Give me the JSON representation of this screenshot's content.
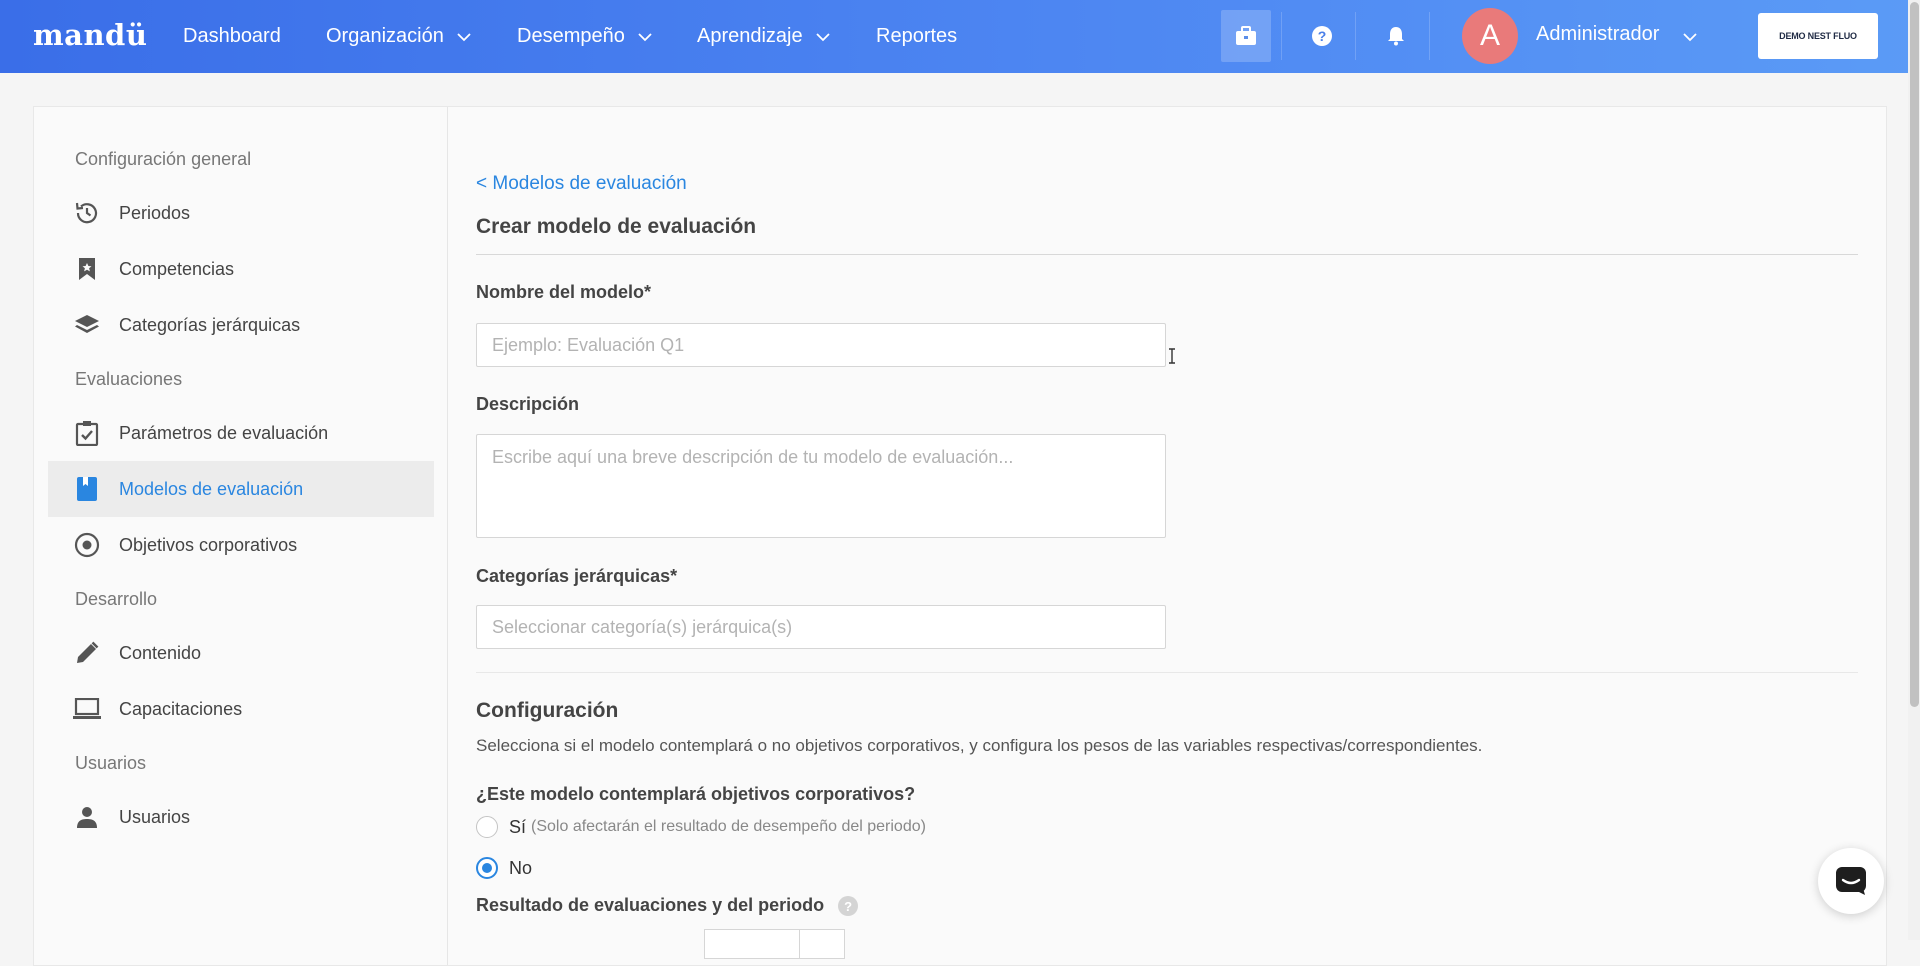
{
  "brand": {
    "logo": "mandü"
  },
  "nav": {
    "items": [
      {
        "label": "Dashboard"
      },
      {
        "label": "Organización"
      },
      {
        "label": "Desempeño"
      },
      {
        "label": "Aprendizaje"
      },
      {
        "label": "Reportes"
      }
    ]
  },
  "user": {
    "initial": "A",
    "name": "Administrador"
  },
  "company_button": "DEMO NEST FLUO",
  "sidebar": {
    "sections": [
      "Configuración general",
      "Evaluaciones",
      "Desarrollo",
      "Usuarios"
    ],
    "items": [
      {
        "label": "Periodos",
        "icon": "history-icon"
      },
      {
        "label": "Competencias",
        "icon": "bookmark-icon"
      },
      {
        "label": "Categorías jerárquicas",
        "icon": "layers-icon"
      },
      {
        "label": "Parámetros de evaluación",
        "icon": "clipboard-check-icon"
      },
      {
        "label": "Modelos de evaluación",
        "icon": "book-icon",
        "active": true
      },
      {
        "label": "Objetivos corporativos",
        "icon": "target-icon"
      },
      {
        "label": "Contenido",
        "icon": "pencil-icon"
      },
      {
        "label": "Capacitaciones",
        "icon": "laptop-icon"
      },
      {
        "label": "Usuarios",
        "icon": "user-icon"
      }
    ]
  },
  "content": {
    "back_link": "< Modelos de evaluación",
    "title": "Crear modelo de evaluación",
    "name_label": "Nombre del modelo*",
    "name_placeholder": "Ejemplo: Evaluación Q1",
    "name_value": "",
    "description_label": "Descripción",
    "description_placeholder": "Escribe aquí una breve descripción de tu modelo de evaluación...",
    "categories_label": "Categorías jerárquicas*",
    "categories_placeholder": "Seleccionar categoría(s) jerárquica(s)",
    "config_title": "Configuración",
    "config_help": "Selecciona si el modelo contemplará o no objetivos corporativos, y configura los pesos de las variables respectivas/correspondientes.",
    "objectives_question": "¿Este modelo contemplará objetivos corporativos?",
    "options": [
      {
        "label": "Sí",
        "note": "(Solo afectarán el resultado de desempeño del periodo)",
        "checked": false
      },
      {
        "label": "No",
        "note": "",
        "checked": true
      }
    ],
    "results_label": "Resultado de evaluaciones y del periodo",
    "help_badge": "?"
  },
  "colors": {
    "accent": "#2a86e0",
    "topbar_start": "#3a6ee8",
    "topbar_end": "#5b9bf6",
    "avatar": "#e97a7a"
  }
}
